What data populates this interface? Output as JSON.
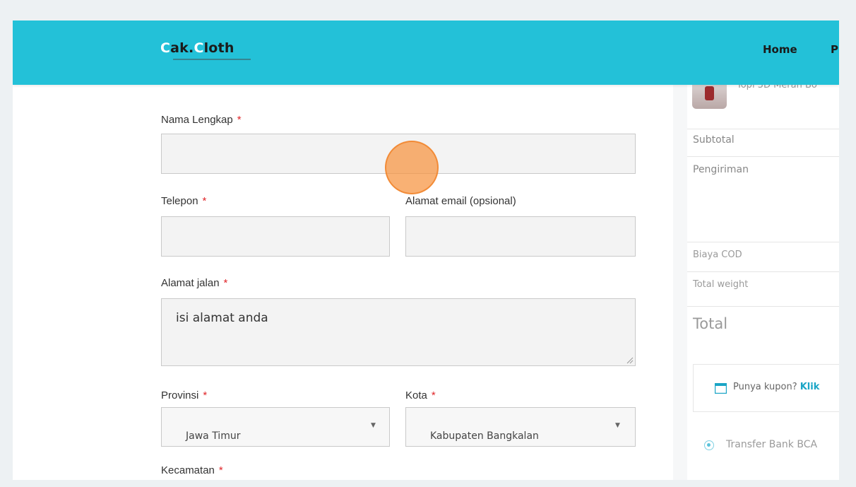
{
  "brand": {
    "logo_c1": "C",
    "logo_mid": "ak.",
    "logo_c2": "C",
    "logo_end": "loth"
  },
  "nav": {
    "home": "Home",
    "next": "P"
  },
  "form": {
    "full_name": {
      "label": "Nama Lengkap",
      "required": "*",
      "value": ""
    },
    "phone": {
      "label": "Telepon",
      "required": "*",
      "value": ""
    },
    "email": {
      "label": "Alamat email (opsional)",
      "value": ""
    },
    "address": {
      "label": "Alamat jalan",
      "required": "*",
      "placeholder": "isi alamat anda"
    },
    "province": {
      "label": "Provinsi",
      "required": "*",
      "selected": "Jawa Timur"
    },
    "city": {
      "label": "Kota",
      "required": "*",
      "selected": "Kabupaten Bangkalan"
    },
    "district": {
      "label": "Kecamatan",
      "required": "*"
    }
  },
  "order_summary": {
    "product_name": "Topi 3D Merah Bo",
    "subtotal_label": "Subtotal",
    "shipping_label": "Pengiriman",
    "cod_label": "Biaya COD",
    "weight_label": "Total weight",
    "total_label": "Total",
    "coupon_text": "Punya kupon?",
    "coupon_link": "Klik",
    "payment_option": "Transfer Bank BCA"
  },
  "colors": {
    "header": "#23c1d8",
    "required": "#e0262a",
    "link": "#1aa5c6",
    "cursor": "#f7933e"
  }
}
